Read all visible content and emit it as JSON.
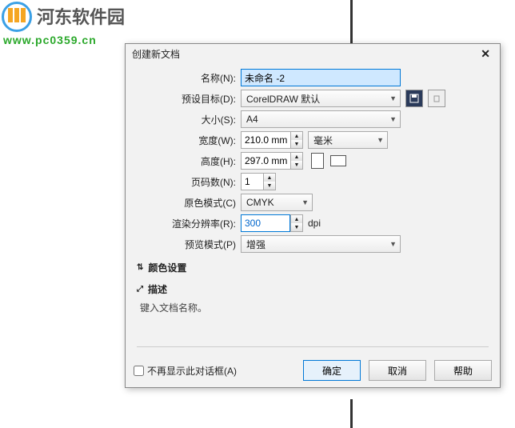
{
  "watermark": {
    "site_name": "河东软件园",
    "url": "www.pc0359.cn"
  },
  "dialog": {
    "title": "创建新文档",
    "labels": {
      "name": "名称(N):",
      "preset": "预设目标(D):",
      "size": "大小(S):",
      "width": "宽度(W):",
      "height": "高度(H):",
      "pages": "页码数(N):",
      "colormode": "原色模式(C)",
      "resolution": "渲染分辨率(R):",
      "preview": "预览模式(P)"
    },
    "values": {
      "name": "未命名 -2",
      "preset": "CorelDRAW 默认",
      "size": "A4",
      "width": "210.0 mm",
      "height": "297.0 mm",
      "width_unit": "毫米",
      "pages": "1",
      "colormode": "CMYK",
      "resolution": "300",
      "resolution_unit": "dpi",
      "preview": "增强"
    },
    "sections": {
      "color_settings": "颜色设置",
      "description_title": "描述",
      "description_text": "键入文档名称。"
    },
    "footer": {
      "dont_show": "不再显示此对话框(A)",
      "ok": "确定",
      "cancel": "取消",
      "help": "帮助"
    }
  }
}
